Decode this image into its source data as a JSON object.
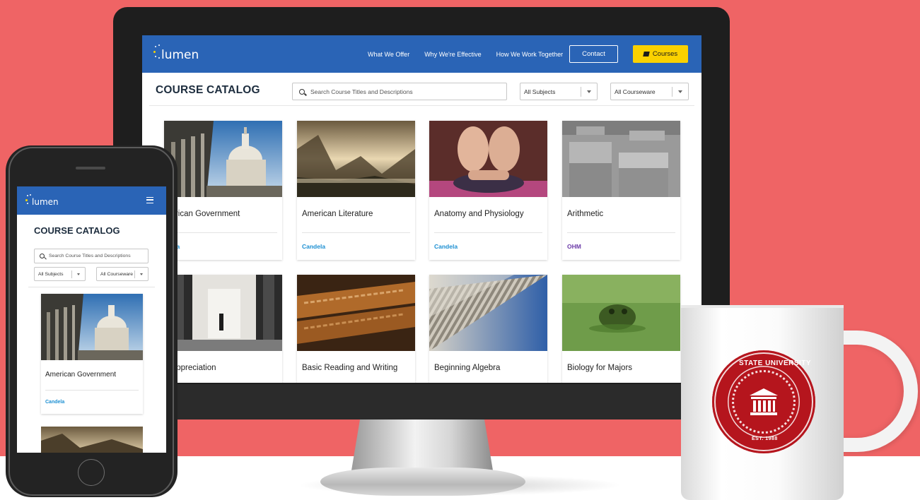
{
  "desktop": {
    "brand": "lumen",
    "nav": [
      "What We Offer",
      "Why We're Effective",
      "How We Work Together"
    ],
    "contact_label": "Contact",
    "courses_label": "Courses",
    "catalog_title": "COURSE CATALOG",
    "search_placeholder": "Search Course Titles and Descriptions",
    "subjects_select": "All Subjects",
    "courseware_select": "All Courseware",
    "courses": [
      {
        "title": "American Government",
        "visible_title": "merican Government",
        "platform": "Candela",
        "visible_platform": "ndela"
      },
      {
        "title": "American Literature",
        "platform": "Candela"
      },
      {
        "title": "Anatomy and Physiology",
        "platform": "Candela"
      },
      {
        "title": "Arithmetic",
        "platform": "OHM"
      },
      {
        "title": "Art Appreciation",
        "visible_title": "rt Appreciation",
        "platform": ""
      },
      {
        "title": "Basic Reading and Writing",
        "platform": ""
      },
      {
        "title": "Beginning Algebra",
        "platform": ""
      },
      {
        "title": "Biology for Majors",
        "platform": ""
      }
    ]
  },
  "mobile": {
    "brand": "lumen",
    "catalog_title": "COURSE CATALOG",
    "search_placeholder": "Search Course Titles and Descriptions",
    "subjects_select": "All Subjects",
    "courseware_select": "All Courseware",
    "course": {
      "title": "American Government",
      "platform": "Candela"
    }
  },
  "mug": {
    "seal_top": "STATE UNIVERSITY",
    "seal_bottom": "EST. 1988"
  },
  "colors": {
    "background": "#ef6465",
    "nav_blue": "#2a64b6",
    "courses_yellow": "#fad100",
    "candela": "#1c8fd2",
    "ohm": "#6b3aa8",
    "seal_red": "#b5151d"
  }
}
